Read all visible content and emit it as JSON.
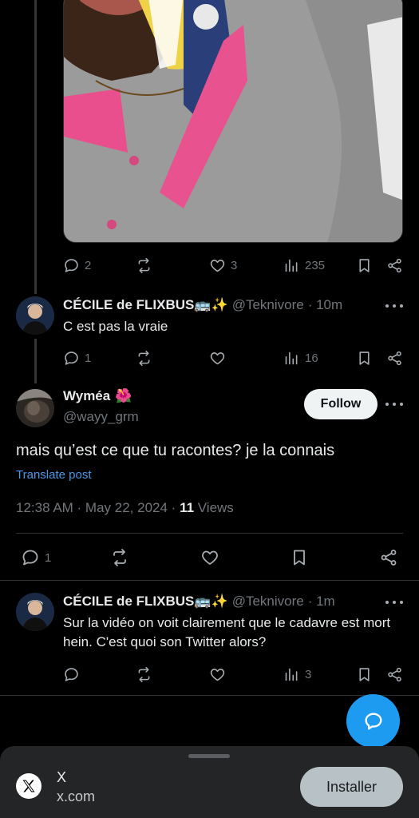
{
  "media": {
    "alt": "Photo of a person wearing a grey and pink polo shirt with a lanyard"
  },
  "first_tweet_actions": {
    "replies": "2",
    "likes": "3",
    "views": "235"
  },
  "reply1": {
    "name": "CÉCILE de FLIXBUS🚌✨",
    "handle": "@Teknivore",
    "time": "· 10m",
    "text": "C est pas la vraie",
    "replies": "1",
    "views": "16"
  },
  "main_tweet": {
    "name": "Wyméa",
    "name_emoji": "🌺",
    "handle": "@wayy_grm",
    "follow_label": "Follow",
    "text": "mais qu’est ce que tu racontes? je la connais",
    "translate_label": "Translate post",
    "timestamp": "12:38 AM · May 22, 2024 · ",
    "views_count": "11",
    "views_label": " Views",
    "replies": "1"
  },
  "reply2": {
    "name": "CÉCILE de FLIXBUS🚌✨",
    "handle": "@Teknivore",
    "time": "· 1m",
    "text": "Sur la vidéo on voit clairement que le cadavre est mort hein. C'est quoi son Twitter alors?",
    "views": "3"
  },
  "install_sheet": {
    "app_name": "X",
    "app_url": "x.com",
    "install_label": "Installer"
  },
  "colors": {
    "accent": "#1d9bf0",
    "link": "#4a99e9",
    "background": "#000000"
  }
}
